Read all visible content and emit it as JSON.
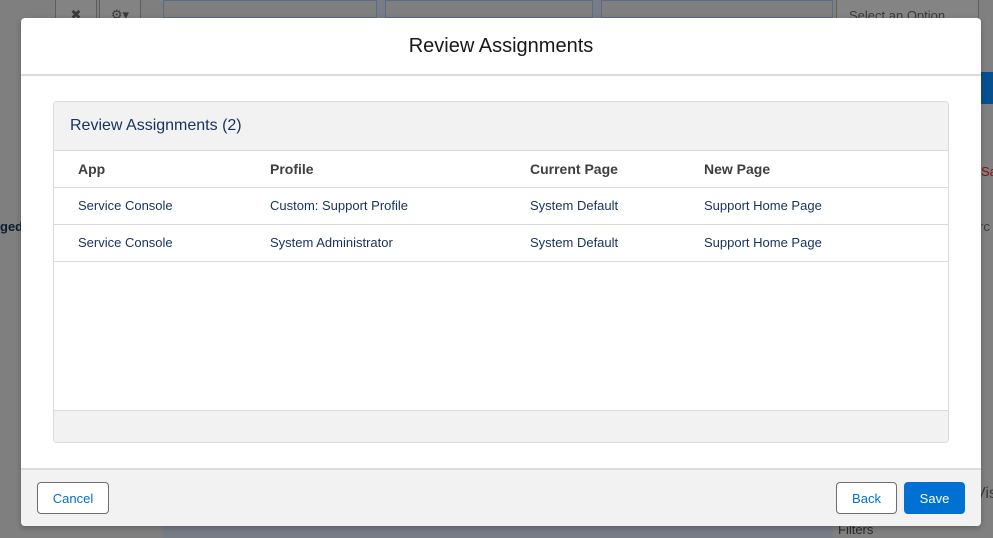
{
  "background": {
    "left_text": "ged",
    "right_select": "Select an Option",
    "right_texts": [
      "Sa",
      "rc",
      "Vis"
    ],
    "filters_label": "Filters"
  },
  "modal": {
    "title": "Review Assignments",
    "card": {
      "title": "Review Assignments (2)",
      "columns": [
        "App",
        "Profile",
        "Current Page",
        "New Page"
      ],
      "rows": [
        [
          "Service Console",
          "Custom: Support Profile",
          "System Default",
          "Support Home Page"
        ],
        [
          "Service Console",
          "System Administrator",
          "System Default",
          "Support Home Page"
        ]
      ]
    },
    "footer": {
      "cancel_label": "Cancel",
      "back_label": "Back",
      "save_label": "Save"
    }
  },
  "colors": {
    "brand": "#0070d2",
    "link": "#16325c",
    "border": "#dddbda",
    "header_bg": "#f3f2f2"
  }
}
